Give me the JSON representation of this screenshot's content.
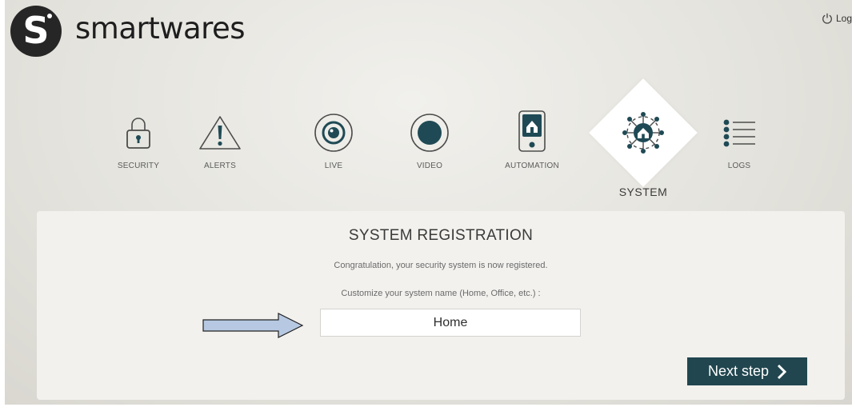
{
  "header": {
    "logo_letter": "S",
    "brand": "smartwares",
    "logout_label": "Log"
  },
  "nav": {
    "items": [
      {
        "label": "SECURITY",
        "icon": "padlock-icon"
      },
      {
        "label": "ALERTS",
        "icon": "warning-triangle-icon"
      },
      {
        "label": "LIVE",
        "icon": "camera-lens-icon"
      },
      {
        "label": "VIDEO",
        "icon": "video-record-icon"
      },
      {
        "label": "AUTOMATION",
        "icon": "smart-plug-icon"
      },
      {
        "label": "SYSTEM",
        "icon": "house-network-icon",
        "active": true
      },
      {
        "label": "LOGS",
        "icon": "list-icon"
      }
    ]
  },
  "registration": {
    "title": "SYSTEM REGISTRATION",
    "message": "Congratulation, your security system is now registered.",
    "prompt": "Customize your system name (Home, Office, etc.) :",
    "system_name_value": "Home",
    "next_label": "Next step"
  },
  "colors": {
    "accent_button": "#21464f",
    "icon_teal": "#1f4a55",
    "arrow_fill": "#b7c9e2"
  }
}
